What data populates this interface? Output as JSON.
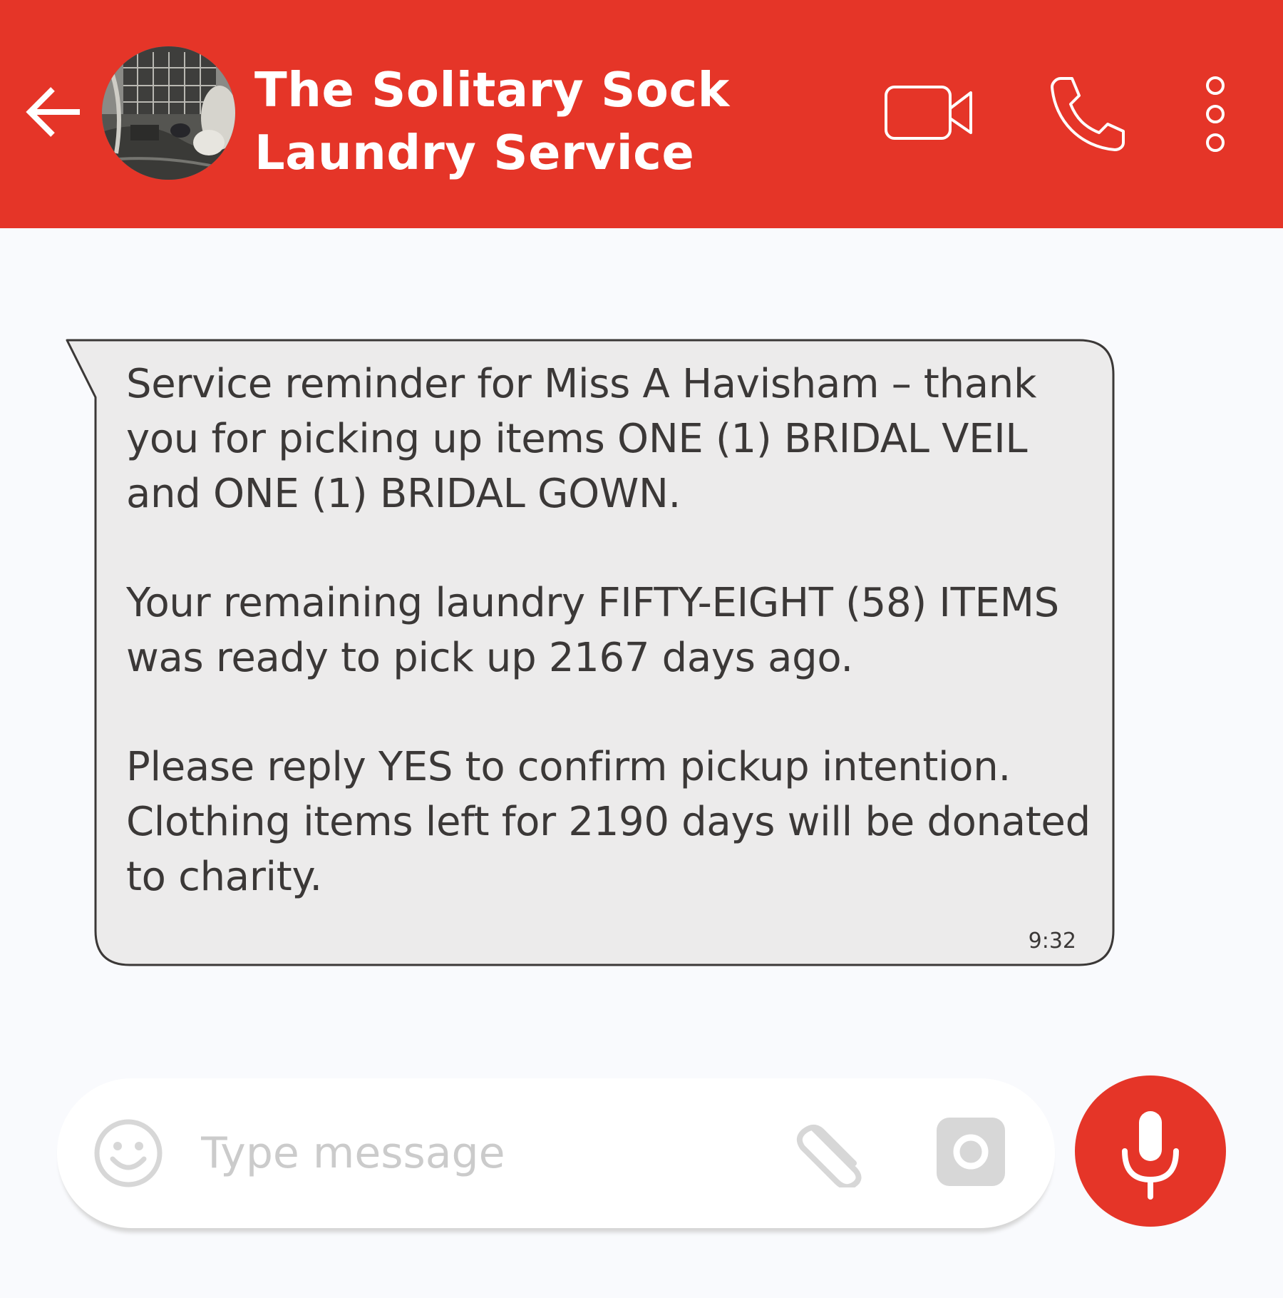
{
  "header": {
    "title_line1": "The Solitary Sock",
    "title_line2": "Laundry Service",
    "back_icon": "back-arrow-icon",
    "video_icon": "video-camera-icon",
    "call_icon": "phone-icon",
    "more_icon": "more-vertical-icon",
    "accent_color": "#e53528"
  },
  "message": {
    "paragraph1": "Service reminder for Miss A Havisham – thank you for picking up items ONE (1) BRIDAL VEIL and ONE (1) BRIDAL GOWN.",
    "paragraph2": "Your remaining laundry FIFTY-EIGHT (58) ITEMS was ready to pick up 2167 days ago.",
    "paragraph3": "Please reply YES to confirm pickup intention. Clothing items left for 2190 days will be donated to charity.",
    "time": "9:32",
    "bubble_color": "#ecebeb"
  },
  "composer": {
    "placeholder": "Type message",
    "emoji_icon": "smiley-icon",
    "attach_icon": "paperclip-icon",
    "camera_icon": "camera-icon",
    "mic_icon": "microphone-icon"
  }
}
